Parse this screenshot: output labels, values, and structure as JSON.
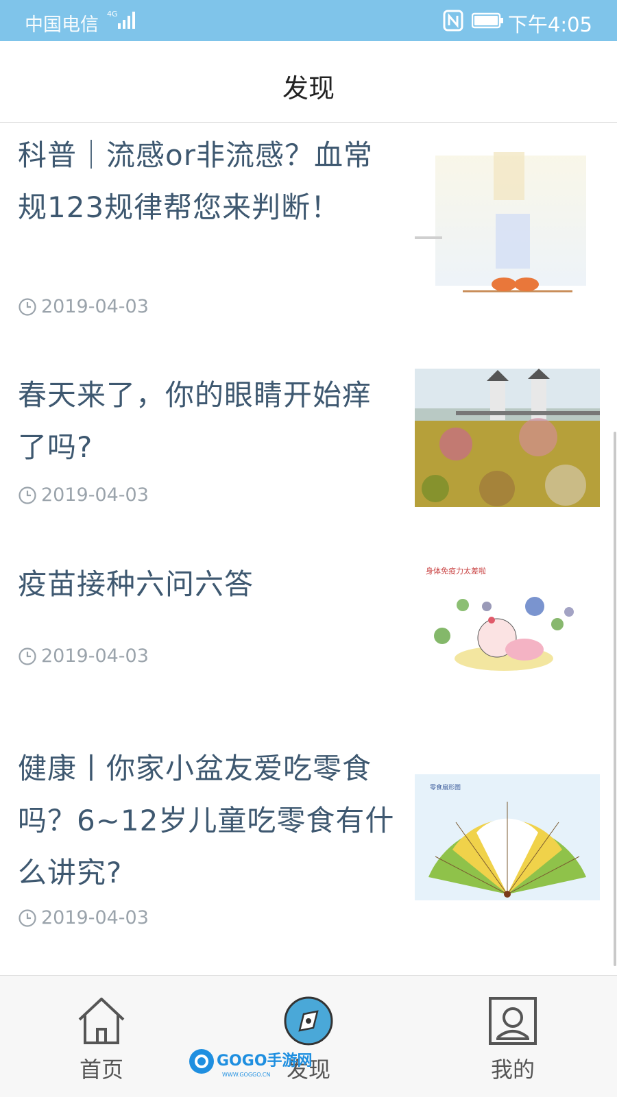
{
  "status_bar": {
    "carrier": "中国电信",
    "network": "4G",
    "time": "下午4:05"
  },
  "header": {
    "title": "发现"
  },
  "articles": [
    {
      "title": "科普｜流感or非流感？血常规123规律帮您来判断！",
      "date": "2019-04-03",
      "thumb_icon": "cartoon-feet-thumbnail"
    },
    {
      "title": "春天来了，你的眼睛开始痒了吗?",
      "date": "2019-04-03",
      "thumb_icon": "flower-field-bridge-thumbnail"
    },
    {
      "title": "疫苗接种六问六答",
      "date": "2019-04-03",
      "thumb_icon": "sick-baby-germs-thumbnail",
      "thumb_caption": "身体免疫力太差啦"
    },
    {
      "title": "健康丨你家小盆友爱吃零食吗？6~12岁儿童吃零食有什么讲究?",
      "date": "2019-04-03",
      "thumb_icon": "snack-fan-chart-thumbnail",
      "thumb_caption": "零食扇形图"
    }
  ],
  "tabs": [
    {
      "label": "首页",
      "icon": "home-icon",
      "active": false
    },
    {
      "label": "发现",
      "icon": "compass-icon",
      "active": true
    },
    {
      "label": "我的",
      "icon": "profile-icon",
      "active": false
    }
  ],
  "watermark": {
    "text": "GOGO手游网",
    "url_text": "WWW.GOGGO.CN"
  },
  "colors": {
    "status_bar": "#7fc4ea",
    "title_text": "#3e5870",
    "date_text": "#9aa3ab",
    "active_tab": "#4aa8d8"
  }
}
